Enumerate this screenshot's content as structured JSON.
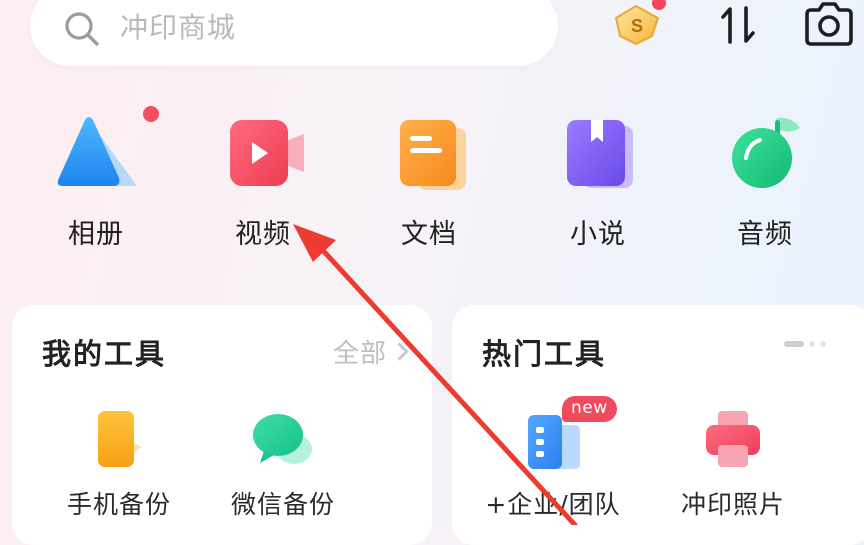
{
  "search": {
    "placeholder": "冲印商城"
  },
  "top_bar": {
    "icons": [
      "coin-icon",
      "sort-icon",
      "camera-icon"
    ]
  },
  "categories": [
    {
      "label": "相册",
      "icon": "album-icon",
      "has_dot": true
    },
    {
      "label": "视频",
      "icon": "video-icon"
    },
    {
      "label": "文档",
      "icon": "document-icon"
    },
    {
      "label": "小说",
      "icon": "novel-icon"
    },
    {
      "label": "音频",
      "icon": "audio-icon"
    }
  ],
  "my_tools": {
    "title": "我的工具",
    "more_label": "全部",
    "items": [
      {
        "label": "手机备份",
        "icon": "phone-backup-icon"
      },
      {
        "label": "微信备份",
        "icon": "wechat-backup-icon"
      }
    ]
  },
  "hot_tools": {
    "title": "热门工具",
    "items": [
      {
        "label": "+企业/团队",
        "icon": "team-icon",
        "badge": "new"
      },
      {
        "label": "冲印照片",
        "icon": "print-photo-icon"
      }
    ]
  },
  "colors": {
    "accent_red": "#ef4f5f",
    "album_blue": "#3aa0f3",
    "video_red": "#f2495e",
    "doc_orange": "#f9962d",
    "novel_purple": "#7a5cf0",
    "audio_green": "#21c885"
  }
}
